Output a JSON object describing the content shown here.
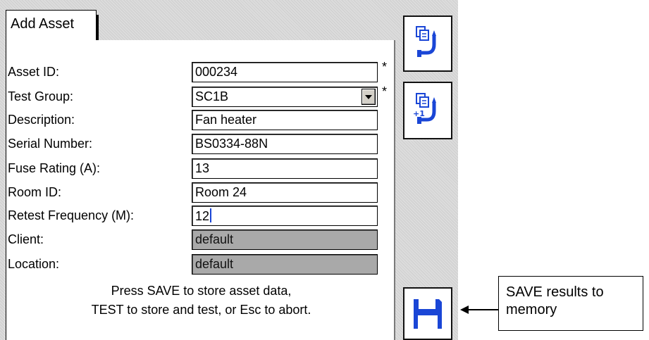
{
  "tab": {
    "label": "Add Asset"
  },
  "form": {
    "fields": [
      {
        "label": "Asset ID:",
        "value": "000234",
        "required": "*"
      },
      {
        "label": "Test Group:",
        "value": "SC1B",
        "required": "*"
      },
      {
        "label": "Description:",
        "value": "Fan heater"
      },
      {
        "label": "Serial Number:",
        "value": "BS0334-88N"
      },
      {
        "label": "Fuse Rating (A):",
        "value": "13"
      },
      {
        "label": "Room ID:",
        "value": "Room 24"
      },
      {
        "label": "Retest Frequency (M):",
        "value": "12"
      },
      {
        "label": "Client:",
        "value": "default"
      },
      {
        "label": "Location:",
        "value": "default"
      }
    ]
  },
  "message": {
    "line1": "Press SAVE to store asset data,",
    "line2": "TEST to store and test, or Esc to abort."
  },
  "buttons": {
    "copy_icon": "copy-asset-icon",
    "copy_increment_icon": "copy-increment-asset-icon",
    "copy_increment_badge": "+1",
    "save_icon": "floppy-disk-icon"
  },
  "callout": {
    "text": "SAVE results to memory"
  },
  "colors": {
    "save_blue": "#1a46d6",
    "readonly_field": "#a9a9a9"
  }
}
